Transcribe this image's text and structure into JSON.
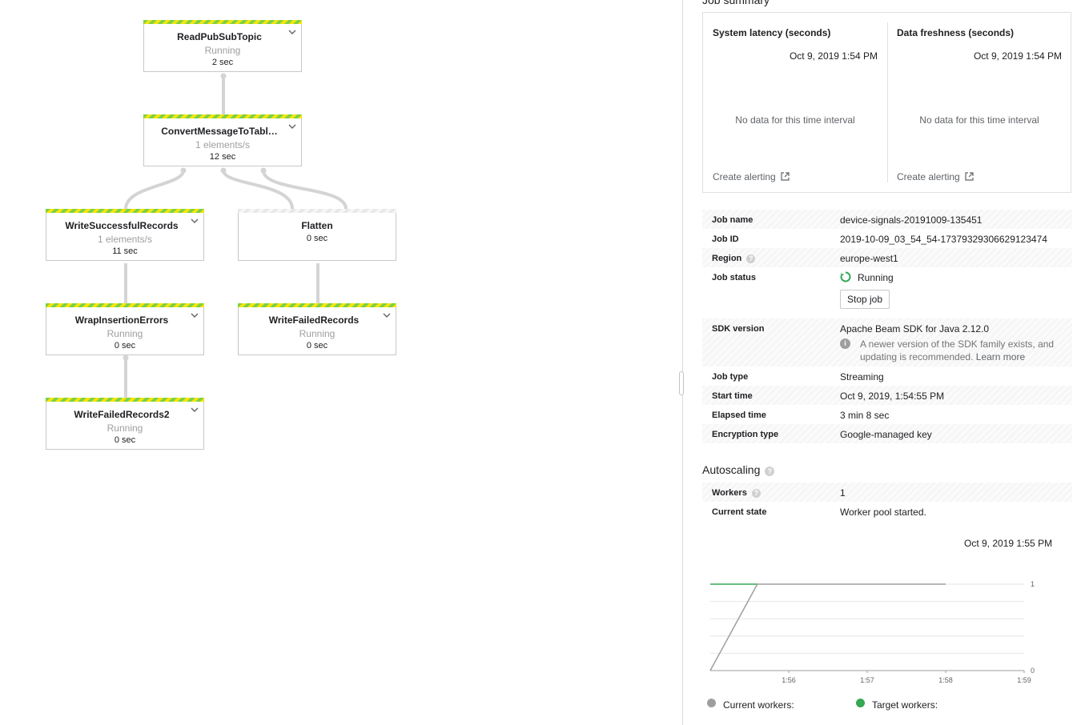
{
  "graph": {
    "steps": [
      {
        "name": "ReadPubSubTopic",
        "status": "Running",
        "time": "2 sec"
      },
      {
        "name": "ConvertMessageToTabl…",
        "status": "1 elements/s",
        "time": "12 sec"
      },
      {
        "name": "WriteSuccessfulRecords",
        "status": "1 elements/s",
        "time": "11 sec"
      },
      {
        "name": "Flatten",
        "status": "",
        "time": "0 sec"
      },
      {
        "name": "WrapInsertionErrors",
        "status": "Running",
        "time": "0 sec"
      },
      {
        "name": "WriteFailedRecords",
        "status": "Running",
        "time": "0 sec"
      },
      {
        "name": "WriteFailedRecords2",
        "status": "Running",
        "time": "0 sec"
      }
    ]
  },
  "summary": {
    "title": "Job summary",
    "metrics": [
      {
        "title": "System latency (seconds)",
        "date": "Oct 9, 2019 1:54 PM",
        "empty": "No data for this time interval",
        "alert_link": "Create alerting"
      },
      {
        "title": "Data freshness (seconds)",
        "date": "Oct 9, 2019 1:54 PM",
        "empty": "No data for this time interval",
        "alert_link": "Create alerting"
      }
    ]
  },
  "job": {
    "name_label": "Job name",
    "name": "device-signals-20191009-135451",
    "id_label": "Job ID",
    "id": "2019-10-09_03_54_54-17379329306629123474",
    "region_label": "Region",
    "region": "europe-west1",
    "status_label": "Job status",
    "status": "Running",
    "stop_label": "Stop job",
    "sdk_label": "SDK version",
    "sdk": "Apache Beam SDK for Java 2.12.0",
    "sdk_note": "A newer version of the SDK family exists, and updating is recommended.",
    "sdk_learn_more": "Learn more",
    "type_label": "Job type",
    "type": "Streaming",
    "start_label": "Start time",
    "start": "Oct 9, 2019, 1:54:55 PM",
    "elapsed_label": "Elapsed time",
    "elapsed": "3 min 8 sec",
    "encryption_label": "Encryption type",
    "encryption": "Google-managed key"
  },
  "autoscaling": {
    "title": "Autoscaling",
    "workers_label": "Workers",
    "workers": "1",
    "state_label": "Current state",
    "state": "Worker pool started.",
    "chart_date": "Oct 9, 2019 1:55 PM",
    "legend_current": "Current workers:",
    "legend_target": "Target workers:"
  },
  "colors": {
    "running_green": "#34a853",
    "current_grey": "#9e9e9e",
    "target_green": "#34a853",
    "stripe_green": "#7bd148",
    "stripe_yellow": "#f5e50a"
  },
  "chart_data": {
    "type": "line",
    "title": "",
    "xlabel": "",
    "ylabel": "",
    "x_ticks": [
      "1:56",
      "1:57",
      "1:58",
      "1:59"
    ],
    "y_ticks": [
      "0",
      "1"
    ],
    "ylim": [
      0,
      1
    ],
    "grid": true,
    "legend": "bottom",
    "series": [
      {
        "name": "Current workers:",
        "color": "#9e9e9e",
        "x": [
          "1:55.0",
          "1:55.6",
          "1:58.0"
        ],
        "values": [
          0,
          1,
          1
        ]
      },
      {
        "name": "Target workers:",
        "color": "#34a853",
        "x": [
          "1:55.0",
          "1:55.6"
        ],
        "values": [
          1,
          1
        ]
      }
    ]
  }
}
